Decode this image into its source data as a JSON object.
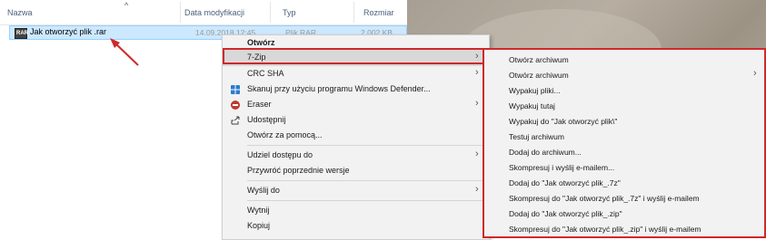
{
  "columns": {
    "name": "Nazwa",
    "date": "Data modyfikacji",
    "type": "Typ",
    "size": "Rozmiar"
  },
  "file": {
    "icon_text": "RAR",
    "name": "Jak otworzyć plik .rar",
    "date": "14.09.2018 12:45",
    "type": "Plik RAR",
    "size": "2 002 KB"
  },
  "context_menu": [
    {
      "label": "Otwórz",
      "bold": true
    },
    {
      "label": "7-Zip",
      "submenu": true,
      "highlighted": true
    },
    {
      "label": "CRC SHA",
      "submenu": true
    },
    {
      "label": "Skanuj przy użyciu programu Windows Defender...",
      "icon": "windows-defender-icon"
    },
    {
      "label": "Eraser",
      "submenu": true,
      "icon": "eraser-icon"
    },
    {
      "label": "Udostępnij",
      "icon": "share-icon"
    },
    {
      "label": "Otwórz za pomocą..."
    },
    {
      "label": "Udziel dostępu do",
      "submenu": true
    },
    {
      "label": "Przywróć poprzednie wersje"
    },
    {
      "label": "Wyślij do",
      "submenu": true
    },
    {
      "label": "Wytnij"
    },
    {
      "label": "Kopiuj"
    }
  ],
  "submenu_7zip": [
    {
      "label": "Otwórz archiwum"
    },
    {
      "label": "Otwórz archiwum",
      "submenu": true
    },
    {
      "label": "Wypakuj pliki..."
    },
    {
      "label": "Wypakuj tutaj"
    },
    {
      "label": "Wypakuj do \"Jak otworzyć plik\\\""
    },
    {
      "label": "Testuj archiwum"
    },
    {
      "label": "Dodaj do archiwum..."
    },
    {
      "label": "Skompresuj i wyślij e-mailem..."
    },
    {
      "label": "Dodaj do \"Jak otworzyć plik_.7z\""
    },
    {
      "label": "Skompresuj do \"Jak otworzyć plik_.7z\" i wyślij e-mailem"
    },
    {
      "label": "Dodaj do \"Jak otworzyć plik_.zip\""
    },
    {
      "label": "Skompresuj do \"Jak otworzyć plik_.zip\" i wyślij e-mailem"
    }
  ],
  "colors": {
    "highlight_border": "#d0282a",
    "selection_bg": "#cce8ff",
    "arrow": "#d0282a"
  }
}
